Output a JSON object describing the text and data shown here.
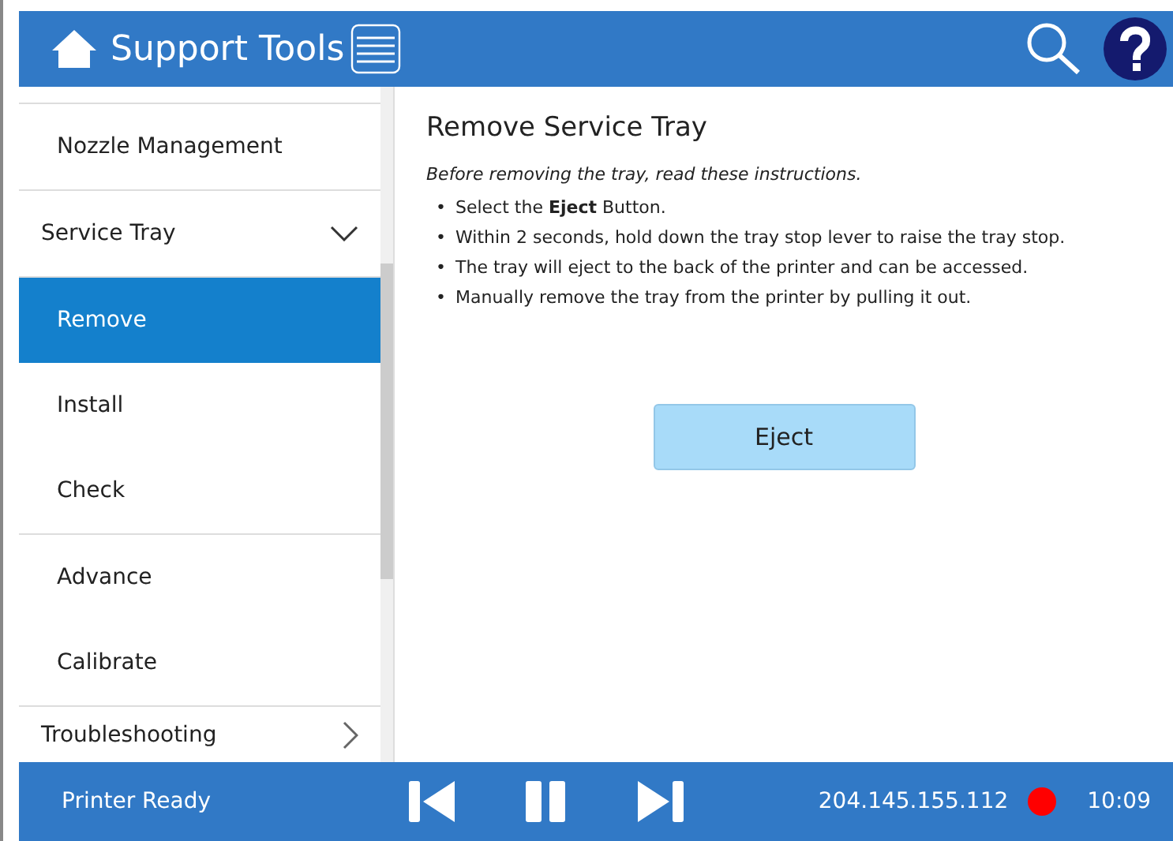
{
  "header": {
    "title": "Support Tools"
  },
  "sidebar": {
    "items": [
      {
        "kind": "item",
        "label": "Nozzle Management",
        "selected": false
      },
      {
        "kind": "group",
        "label": "Service Tray",
        "expanded": true,
        "selected": false
      },
      {
        "kind": "item",
        "label": "Remove",
        "selected": true
      },
      {
        "kind": "item",
        "label": "Install",
        "selected": false
      },
      {
        "kind": "item",
        "label": "Check",
        "selected": false
      },
      {
        "kind": "item",
        "label": "Advance",
        "selected": false
      },
      {
        "kind": "item",
        "label": "Calibrate",
        "selected": false
      },
      {
        "kind": "group",
        "label": "Troubleshooting",
        "expanded": false,
        "selected": false
      }
    ]
  },
  "content": {
    "title": "Remove Service Tray",
    "intro": "Before removing the tray, read these instructions.",
    "steps": [
      {
        "bullet": "•",
        "text": "Select the **Eject** Button."
      },
      {
        "bullet": "•",
        "text": "Within 2 seconds, hold down the tray stop lever to raise the tray stop."
      },
      {
        "bullet": "•",
        "text": "The tray will eject to the back of the printer and can be accessed."
      },
      {
        "bullet": "•",
        "text": "Manually remove the tray from the printer by pulling it out."
      }
    ],
    "button": "Eject"
  },
  "status_bar": {
    "status": "Printer Ready",
    "ip": "204.145.155.112",
    "alert": true,
    "time": "10:09"
  }
}
